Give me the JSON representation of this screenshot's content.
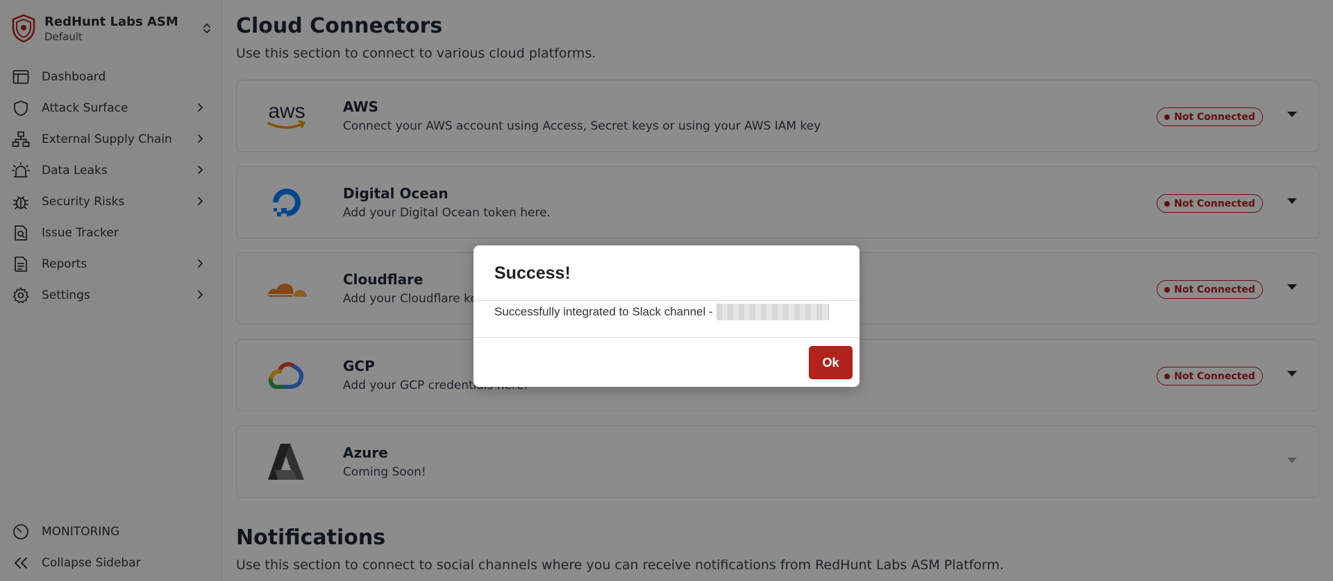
{
  "org": {
    "name": "RedHunt Labs ASM",
    "workspace": "Default",
    "logo_icon": "shield-logo-icon",
    "switch_icon": "chevron-up-down-icon"
  },
  "sidebar": {
    "items": [
      {
        "label": "Dashboard",
        "icon": "dashboard-icon",
        "has_submenu": false
      },
      {
        "label": "Attack Surface",
        "icon": "shield-icon",
        "has_submenu": true
      },
      {
        "label": "External Supply Chain",
        "icon": "network-icon",
        "has_submenu": true
      },
      {
        "label": "Data Leaks",
        "icon": "alarm-icon",
        "has_submenu": true
      },
      {
        "label": "Security Risks",
        "icon": "bug-icon",
        "has_submenu": true
      },
      {
        "label": "Issue Tracker",
        "icon": "file-search-icon",
        "has_submenu": false
      },
      {
        "label": "Reports",
        "icon": "document-icon",
        "has_submenu": true
      },
      {
        "label": "Settings",
        "icon": "gear-icon",
        "has_submenu": true
      }
    ],
    "monitoring_label": "MONITORING",
    "collapse_label": "Collapse Sidebar"
  },
  "cloud": {
    "title": "Cloud Connectors",
    "subtitle": "Use this section to connect to various cloud platforms.",
    "connectors": [
      {
        "name": "AWS",
        "description": "Connect your AWS account using Access, Secret keys or using your AWS IAM key",
        "status": "Not Connected",
        "logo": "aws-logo",
        "logo_text": "aws"
      },
      {
        "name": "Digital Ocean",
        "description": "Add your Digital Ocean token here.",
        "status": "Not Connected",
        "logo": "digital-ocean-logo"
      },
      {
        "name": "Cloudflare",
        "description": "Add your Cloudflare key here.",
        "status": "Not Connected",
        "logo": "cloudflare-logo"
      },
      {
        "name": "GCP",
        "description": "Add your GCP credentials here.",
        "status": "Not Connected",
        "logo": "gcp-logo"
      },
      {
        "name": "Azure",
        "description": "Coming Soon!",
        "status": "",
        "logo": "azure-logo"
      }
    ]
  },
  "notifications": {
    "title": "Notifications",
    "subtitle": "Use this section to connect to social channels where you can receive notifications from RedHunt Labs ASM Platform."
  },
  "modal": {
    "title": "Success!",
    "message": "Successfully integrated to Slack channel -",
    "ok_label": "Ok"
  },
  "colors": {
    "brand_red": "#b1231b",
    "status_red": "#b91c1c"
  }
}
